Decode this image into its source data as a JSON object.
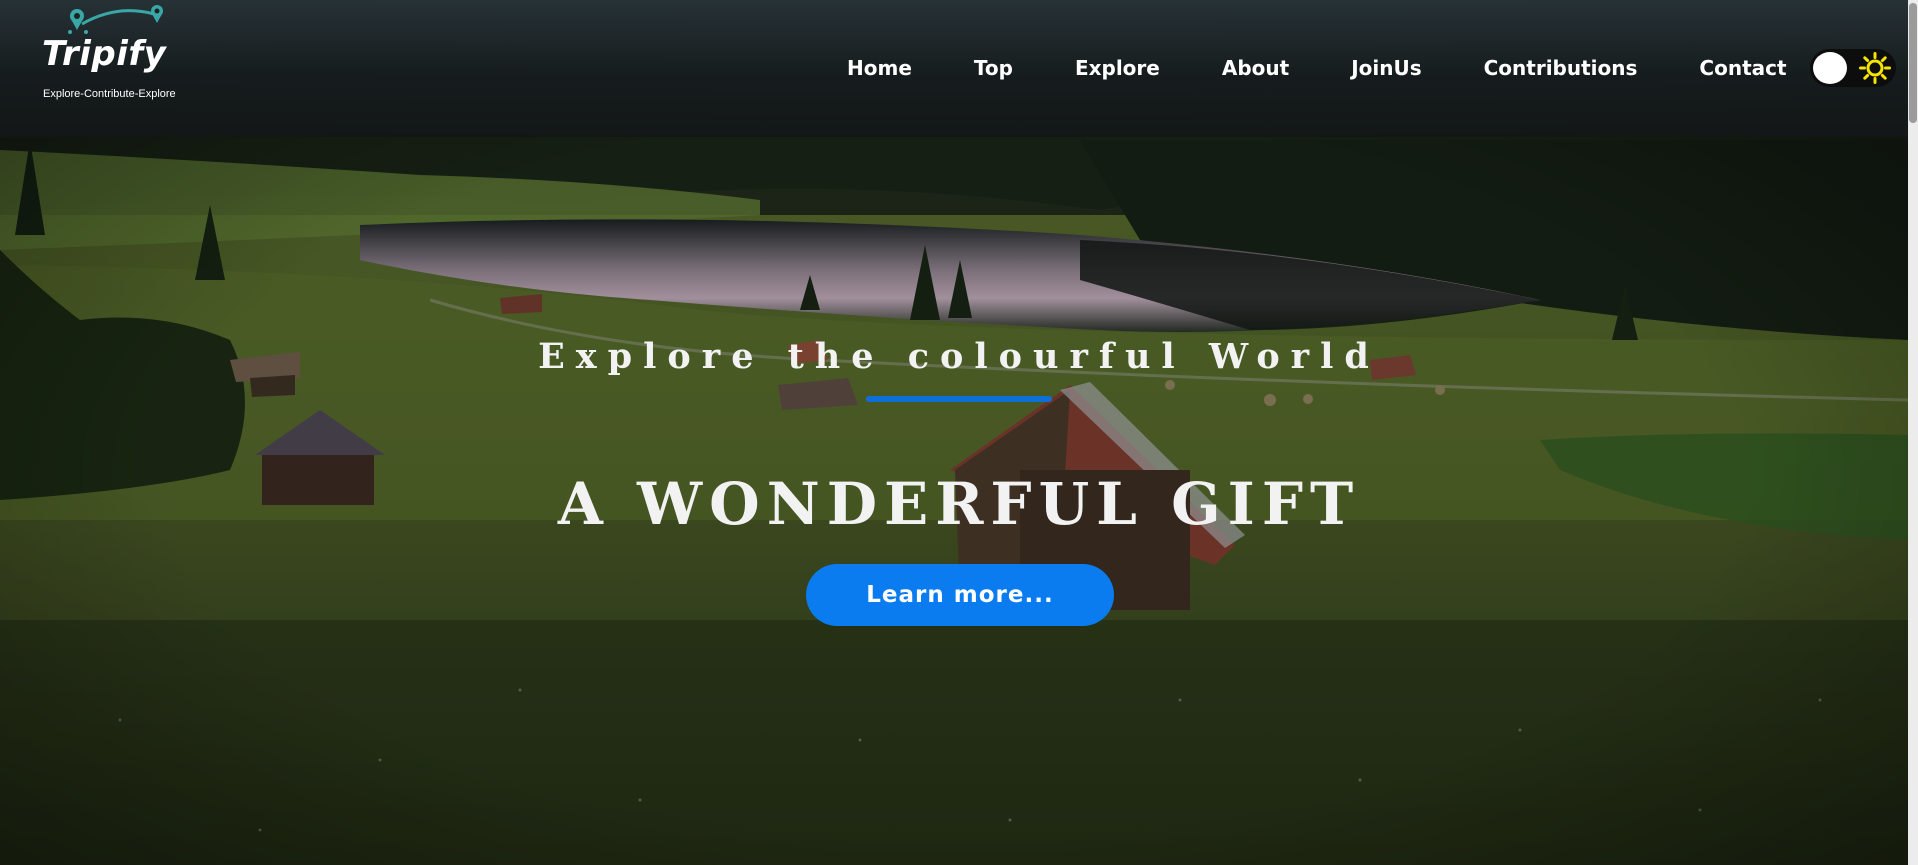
{
  "brand": {
    "name": "Tripify",
    "tagline": "Explore-Contribute-Explore"
  },
  "nav": {
    "links": [
      "Home",
      "Top",
      "Explore",
      "About",
      "JoinUs",
      "Contributions",
      "Contact"
    ]
  },
  "theme_toggle": {
    "mode_icon": "sun-icon",
    "state": "light"
  },
  "hero": {
    "subtitle": "Explore the colourful World",
    "title": "A WONDERFUL GIFT",
    "cta_label": "Learn more..."
  },
  "colors": {
    "accent": "#0a7cf0",
    "underline": "#0f6fd8",
    "sun": "#f5e500",
    "brand_pins": "#3aa7a7"
  }
}
